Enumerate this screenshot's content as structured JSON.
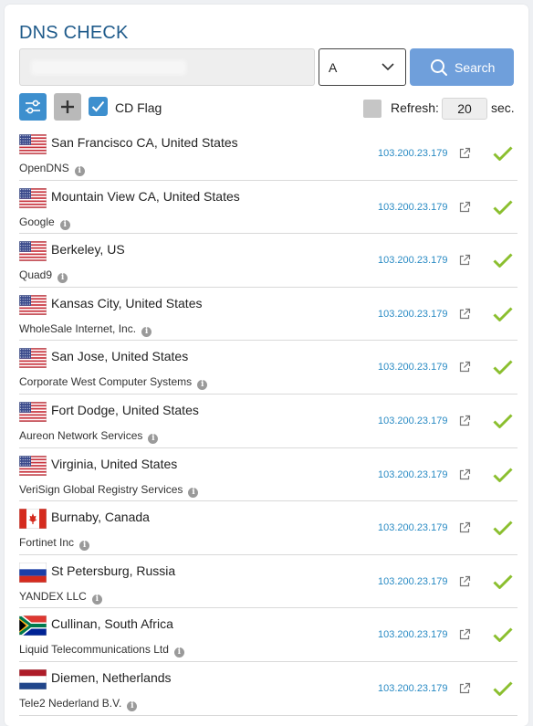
{
  "header": {
    "title": "DNS CHECK"
  },
  "search": {
    "host_value": "",
    "record_type": "A",
    "button_label": "Search"
  },
  "controls": {
    "cd_flag_label": "CD Flag",
    "cd_flag_checked": true,
    "refresh_label": "Refresh:",
    "refresh_checked": false,
    "refresh_value": "20",
    "refresh_unit": "sec."
  },
  "colors": {
    "accent": "#3d8fce",
    "search_button": "#6f9fdb",
    "title": "#1e5a8a",
    "ip_link": "#2a8bc4",
    "ok_check": "#8bbf2f"
  },
  "servers": [
    {
      "flag": "us",
      "location": "San Francisco CA, United States",
      "provider": "OpenDNS",
      "ip": "103.200.23.179",
      "status": "ok"
    },
    {
      "flag": "us",
      "location": "Mountain View CA, United States",
      "provider": "Google",
      "ip": "103.200.23.179",
      "status": "ok"
    },
    {
      "flag": "us",
      "location": "Berkeley, US",
      "provider": "Quad9",
      "ip": "103.200.23.179",
      "status": "ok"
    },
    {
      "flag": "us",
      "location": "Kansas City, United States",
      "provider": "WholeSale Internet, Inc.",
      "ip": "103.200.23.179",
      "status": "ok"
    },
    {
      "flag": "us",
      "location": "San Jose, United States",
      "provider": "Corporate West Computer Systems",
      "ip": "103.200.23.179",
      "status": "ok"
    },
    {
      "flag": "us",
      "location": "Fort Dodge, United States",
      "provider": "Aureon Network Services",
      "ip": "103.200.23.179",
      "status": "ok"
    },
    {
      "flag": "us",
      "location": "Virginia, United States",
      "provider": "VeriSign Global Registry Services",
      "ip": "103.200.23.179",
      "status": "ok"
    },
    {
      "flag": "ca",
      "location": "Burnaby, Canada",
      "provider": "Fortinet Inc",
      "ip": "103.200.23.179",
      "status": "ok"
    },
    {
      "flag": "ru",
      "location": "St Petersburg, Russia",
      "provider": "YANDEX LLC",
      "ip": "103.200.23.179",
      "status": "ok"
    },
    {
      "flag": "za",
      "location": "Cullinan, South Africa",
      "provider": "Liquid Telecommunications Ltd",
      "ip": "103.200.23.179",
      "status": "ok"
    },
    {
      "flag": "nl",
      "location": "Diemen, Netherlands",
      "provider": "Tele2 Nederland B.V.",
      "ip": "103.200.23.179",
      "status": "ok"
    }
  ]
}
